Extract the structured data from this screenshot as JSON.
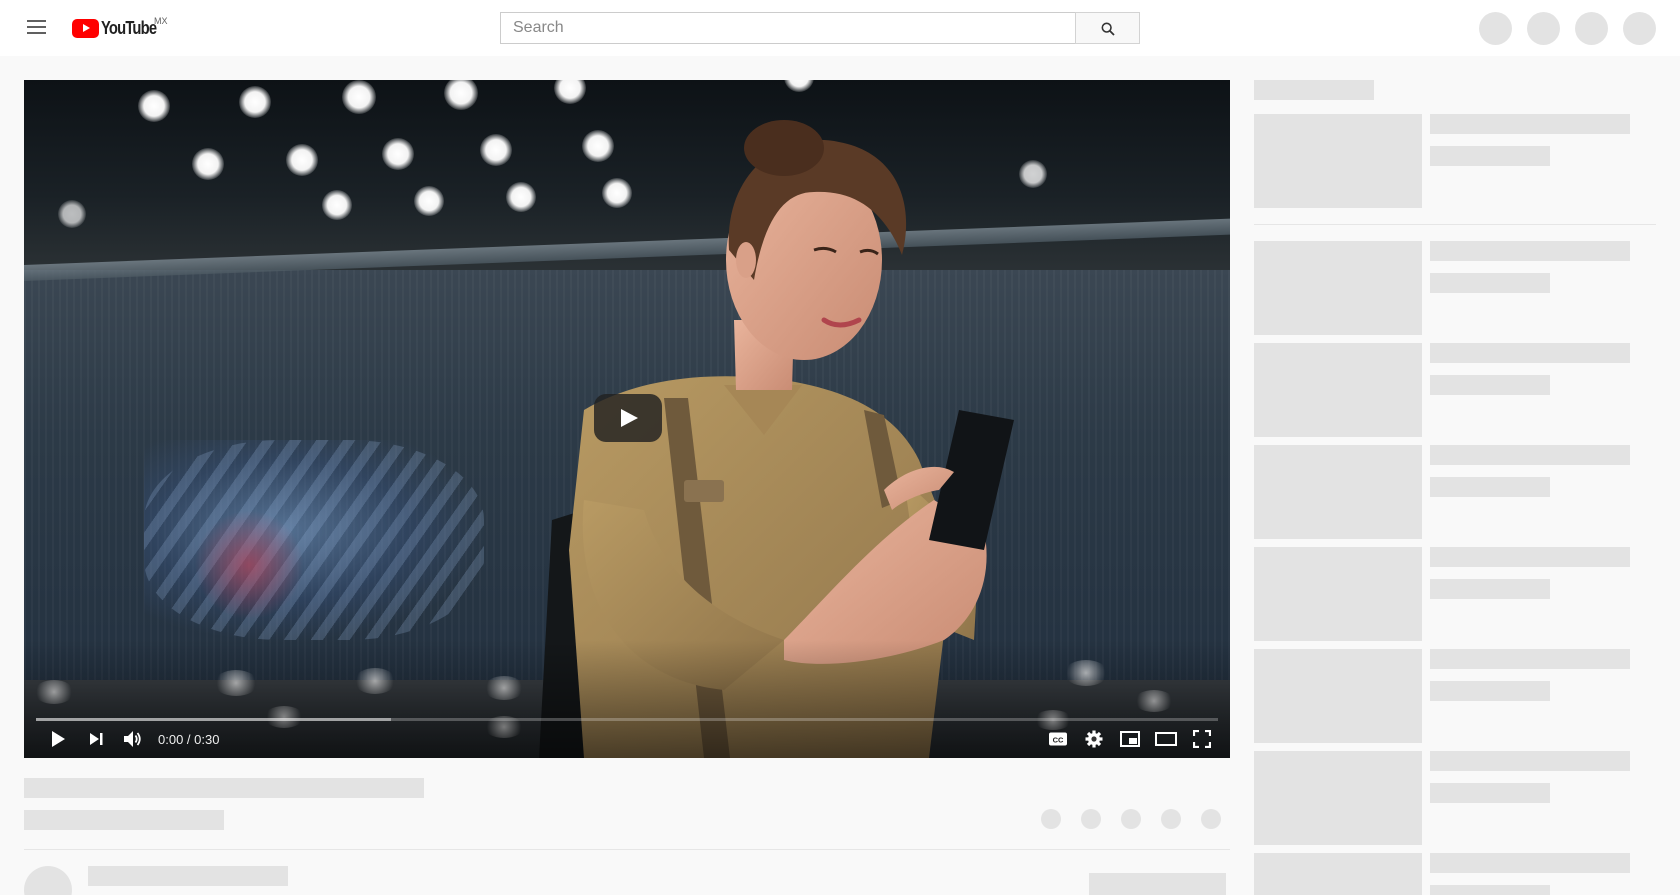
{
  "masthead": {
    "logo_text": "YouTube",
    "country_code": "MX",
    "search_placeholder": "Search",
    "icons": [
      "hamburger-menu-icon",
      "search-icon"
    ]
  },
  "player": {
    "time_display": "0:00 / 0:30",
    "loaded_fraction": 0.3,
    "played_fraction": 0.0,
    "controls": [
      "play-icon",
      "next-icon",
      "volume-icon",
      "captions-icon",
      "settings-icon",
      "miniplayer-icon",
      "theater-mode-icon",
      "fullscreen-icon"
    ]
  },
  "colors": {
    "brand_red": "#ff0000",
    "placeholder_gray": "#e3e3e3",
    "page_bg": "#f9f9f9"
  }
}
